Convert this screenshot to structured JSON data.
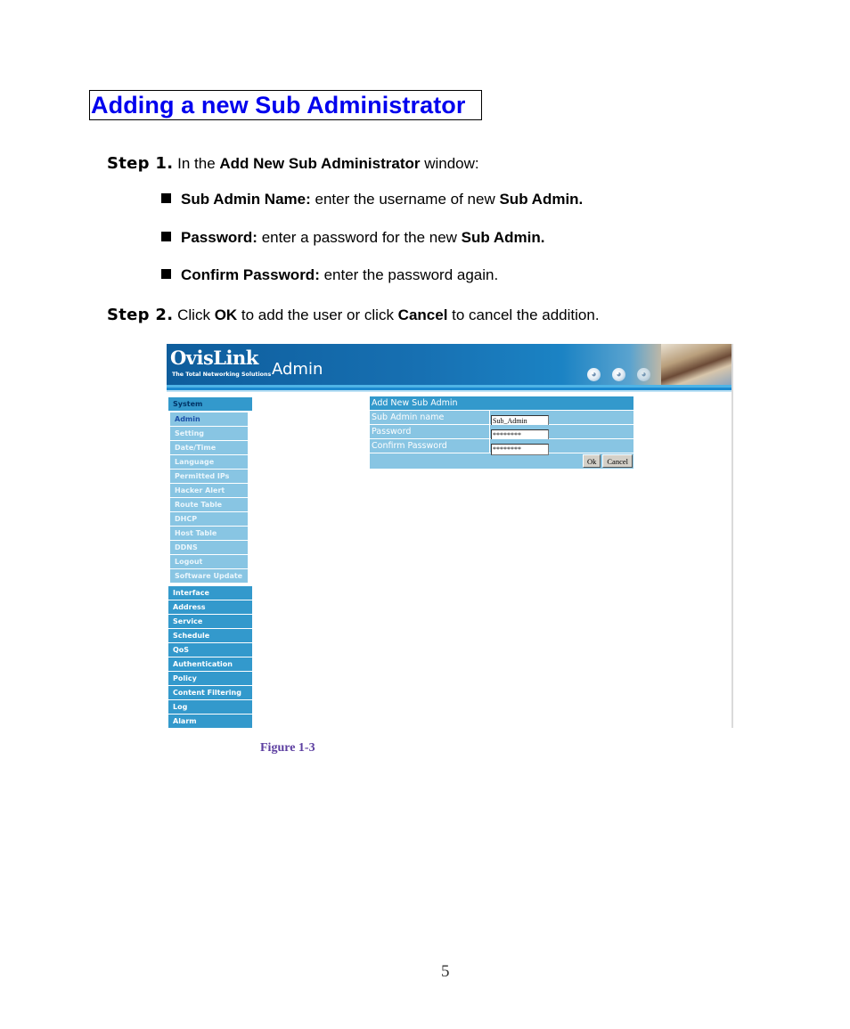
{
  "heading": "Adding a new Sub Administrator",
  "steps": [
    {
      "label": "Step 1.",
      "parts": [
        "In the ",
        "Add New Sub Administrator",
        " window:"
      ]
    },
    {
      "label": "Step 2.",
      "parts": [
        "Click ",
        "OK",
        " to add the user or click ",
        "Cancel",
        " to cancel the addition."
      ]
    }
  ],
  "bullets": [
    {
      "term": "Sub Admin Name:",
      "text": " enter the username of new ",
      "emph": "Sub Admin."
    },
    {
      "term": "Password:",
      "text": " enter a password for the new ",
      "emph": "Sub Admin."
    },
    {
      "term": "Confirm Password:",
      "text": " enter the password again.",
      "emph": ""
    }
  ],
  "screenshot": {
    "banner": {
      "logo": "OvisLink",
      "tagline": "The Total Networking Solutions",
      "title": "Admin",
      "globe_icons": [
        "globe-icon",
        "globe-icon",
        "globe-icon",
        "globe-icon"
      ]
    },
    "menu": {
      "system_header": "System",
      "system_items": [
        {
          "label": "Admin",
          "active": true
        },
        {
          "label": "Setting"
        },
        {
          "label": "Date/Time"
        },
        {
          "label": "Language"
        },
        {
          "label": "Permitted IPs"
        },
        {
          "label": "Hacker Alert"
        },
        {
          "label": "Route Table"
        },
        {
          "label": "DHCP"
        },
        {
          "label": "Host Table"
        },
        {
          "label": "DDNS"
        },
        {
          "label": "Logout"
        },
        {
          "label": "Software Update"
        }
      ],
      "main_items": [
        "Interface",
        "Address",
        "Service",
        "Schedule",
        "QoS",
        "Authentication",
        "Policy",
        "Content Filtering",
        "Log",
        "Alarm"
      ]
    },
    "form": {
      "title": "Add New Sub Admin",
      "fields": [
        {
          "label": "Sub Admin name",
          "value": "Sub_Admin",
          "type": "text"
        },
        {
          "label": "Password",
          "value": "********",
          "type": "password"
        },
        {
          "label": "Confirm Password",
          "value": "********",
          "type": "password"
        }
      ],
      "ok_label": "Ok",
      "cancel_label": "Cancel"
    }
  },
  "caption": "Figure 1-3",
  "page_number": "5",
  "colors": {
    "heading": "#0000ee",
    "menu_dark": "#3399cc",
    "menu_light": "#88c5e3",
    "caption": "#5c3ea0"
  }
}
